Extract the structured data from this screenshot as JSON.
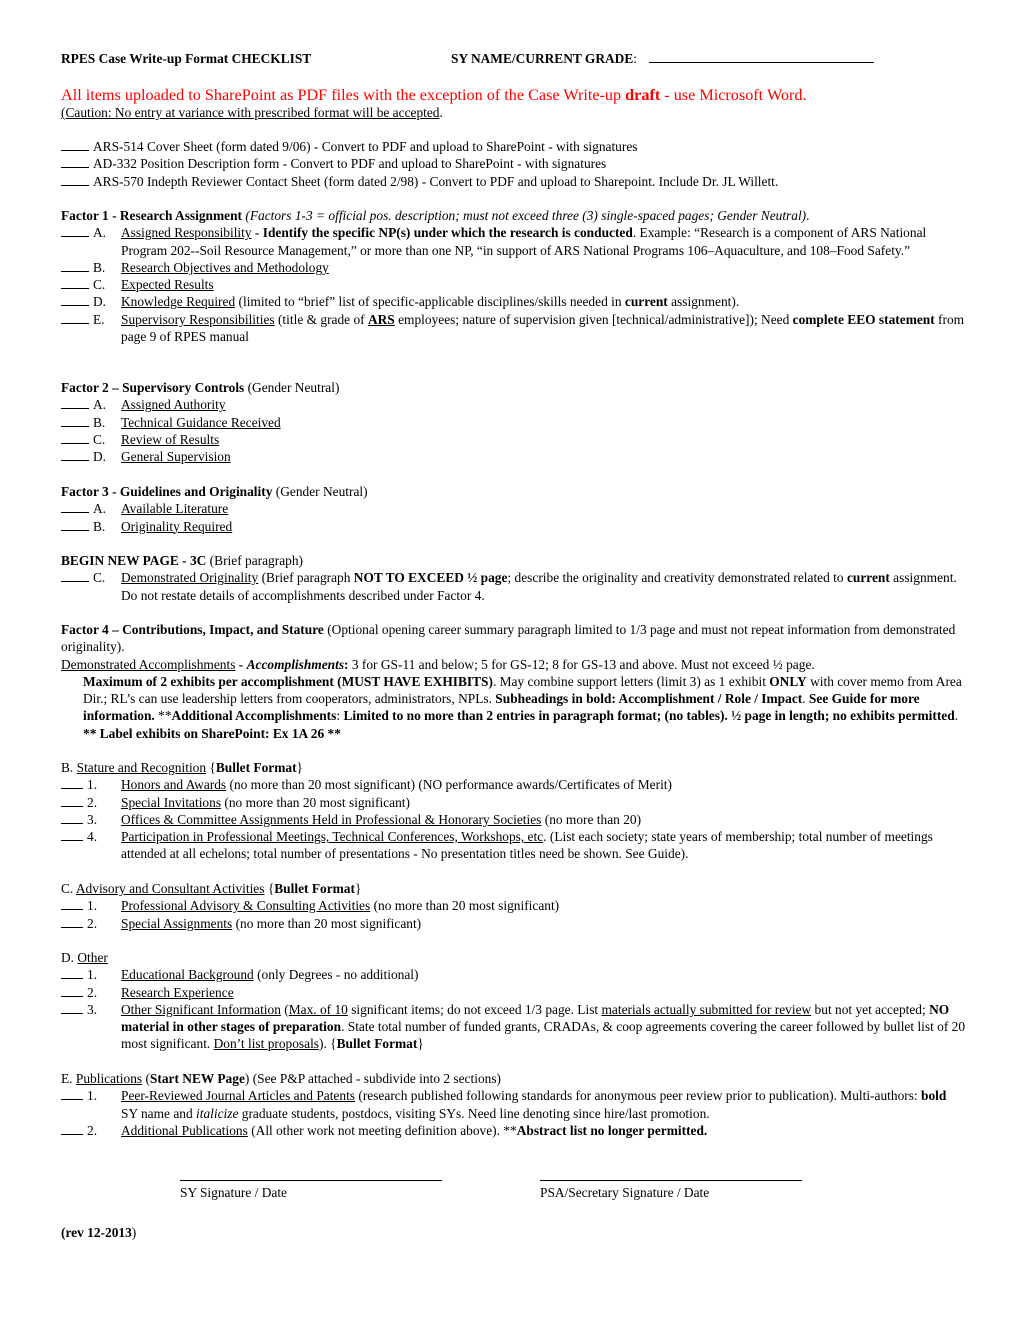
{
  "header": {
    "title": "RPES Case Write-up Format CHECKLIST",
    "sy_label": "SY NAME/CURRENT GRADE",
    "sy_colon": ":",
    "sy_value": ""
  },
  "notice": {
    "part1": "All items uploaded to SharePoint as PDF files with the exception of the Case Write-up ",
    "bold": "draft",
    "part2": " - use Microsoft Word."
  },
  "caution": {
    "text": "(Caution: No entry at variance with prescribed format will be accepted",
    "end": "."
  },
  "forms": [
    {
      "text": "ARS-514 Cover Sheet (form dated 9/06) - Convert to PDF and upload to SharePoint - with signatures"
    },
    {
      "text": "AD-332 Position Description form - Convert to PDF and upload to SharePoint - with signatures"
    },
    {
      "text": "ARS-570 Indepth Reviewer Contact Sheet (form dated 2/98) - Convert to PDF and upload to Sharepoint. Include Dr. JL Willett."
    }
  ],
  "factor1": {
    "title": "Factor 1 - Research Assignment",
    "note": "(Factors 1-3 = official pos. description; must not exceed three (3) single-spaced pages; Gender Neutral)",
    "note_end": ".",
    "items": [
      {
        "letter": "A.",
        "label": "Assigned Responsibility",
        "sep": " - ",
        "bold": "Identify the specific NP(s) under which the research is conducted",
        "rest": ". Example: “Research is a component of ARS National Program 202--Soil Resource Management,” or more than one NP, “in support of ARS National Programs 106–Aquaculture, and 108–Food Safety.”"
      },
      {
        "letter": "B.",
        "label": "Research Objectives and Methodology"
      },
      {
        "letter": "C.",
        "label": "Expected Results"
      },
      {
        "letter": "D.",
        "label": "Knowledge Required",
        "rest1": " (limited to “brief” list of specific-applicable disciplines/skills needed in ",
        "bold": "current",
        "rest2": " assignment)."
      },
      {
        "letter": "E.",
        "label": "Supervisory Responsibilities",
        "rest1": " (title & grade of ",
        "ars": "ARS",
        "rest2": " employees; nature of supervision given [technical/administrative]); Need ",
        "bold1": "complete EEO statement",
        "rest3": " from page 9 of RPES manual"
      }
    ]
  },
  "factor2": {
    "title": "Factor 2 – Supervisory Controls",
    "note": " (Gender Neutral)",
    "items": [
      {
        "letter": "A.",
        "label": "Assigned Authority"
      },
      {
        "letter": "B.",
        "label": "Technical Guidance Received"
      },
      {
        "letter": "C.",
        "label": "Review of Results"
      },
      {
        "letter": "D.",
        "label": "General Supervision"
      }
    ]
  },
  "factor3": {
    "title": "Factor 3 - Guidelines and Originality",
    "note": " (Gender Neutral)",
    "items": [
      {
        "letter": "A.",
        "label": "Available Literature"
      },
      {
        "letter": "B.",
        "label": "Originality Required"
      }
    ]
  },
  "newpage3c": {
    "title": "BEGIN NEW PAGE - 3C",
    "note": " (Brief paragraph)",
    "item": {
      "letter": "C.",
      "label": "Demonstrated Originality",
      "rest1": " (Brief paragraph ",
      "bold1": "NOT TO EXCEED ½ page",
      "rest2": "; describe the originality and creativity demonstrated related to ",
      "bold2": "current",
      "rest3": " assignment.  Do not restate details of accomplishments described under Factor 4."
    }
  },
  "factor4": {
    "title": "Factor 4 – Contributions, Impact, and Stature",
    "note": " (Optional opening career summary paragraph limited to 1/3 page and must not repeat information from demonstrated originality).",
    "accomplishments": {
      "label": "Demonstrated Accomplishments",
      "sep": " - ",
      "bold_italic": "Accomplishments",
      "colon": ":",
      "rest": "  3 for GS-11 and below; 5 for GS-12; 8 for GS-13 and above.  Must not exceed ½ page.",
      "bold1": "Maximum of 2 exhibits per accomplishment (MUST HAVE EXHIBITS)",
      "text1": ". May combine support letters (limit 3) as 1 exhibit ",
      "bold2": "ONLY",
      "text2": " with cover memo from Area Dir.; RL’s can use leadership letters from cooperators, administrators, NPLs. ",
      "bold3": "Subheadings in bold: Accomplishment / Role / Impact",
      "text3": ". ",
      "bold4": "See Guide for more information.",
      "text4": "  **",
      "bold5": "Additional Accomplishments",
      "text5": ": ",
      "bold6": "Limited to no more than 2 entries in paragraph format; (no tables).  ½ page in length; no exhibits permitted",
      "text6": ". ",
      "bold7": "** Label exhibits on SharePoint:  Ex 1A 26 **"
    }
  },
  "sectionB": {
    "letter": "B.",
    "label": "Stature and Recognition",
    "brace_open": " {",
    "bold": "Bullet Format",
    "brace_close": "}",
    "items": [
      {
        "num": "1.",
        "label": "Honors and Awards",
        "rest": " (no more than 20 most significant) (NO performance awards/Certificates of Merit)"
      },
      {
        "num": "2.",
        "label": "Special Invitations",
        "rest": " (no more than 20 most significant)"
      },
      {
        "num": "3.",
        "label": "Offices & Committee Assignments Held in Professional & Honorary Societies",
        "rest": " (no more than 20)"
      },
      {
        "num": "4.",
        "label": "Participation in Professional Meetings, Technical Conferences, Workshops, etc",
        "rest": ". (List each society; state years of membership; total number of meetings attended at all echelons; total number of presentations - No presentation titles need be shown.  See Guide)."
      }
    ]
  },
  "sectionC": {
    "letter": "C.",
    "label": "Advisory and Consultant Activities",
    "brace_open": " {",
    "bold": "Bullet Format",
    "brace_close": "}",
    "items": [
      {
        "num": "1.",
        "label": "Professional Advisory & Consulting Activities",
        "rest": " (no more than 20 most significant)"
      },
      {
        "num": "2.",
        "label": "Special Assignments",
        "rest": " (no more than 20 most significant)"
      }
    ]
  },
  "sectionD": {
    "letter": "D.",
    "label": "Other",
    "items": [
      {
        "num": "1.",
        "label": "Educational Background",
        "rest": " (only Degrees - no additional)"
      },
      {
        "num": "2.",
        "label": "Research Experience",
        "rest": ""
      },
      {
        "num": "3.",
        "label": "Other Significant Information",
        "t1": " (",
        "u1": "Max. of 10",
        "t2": " significant items; do not exceed 1/3 page.  List ",
        "u2": "materials actually submitted for review",
        "t3": " but not yet accepted; ",
        "b1": "NO material in other stages of preparation",
        "t4": ". State total number of funded grants, CRADAs, & coop agreements covering the career followed by bullet list of 20 most significant. ",
        "u3": "Don’t list proposals",
        "t5": ").  {",
        "b2": "Bullet Format",
        "t6": "}"
      }
    ]
  },
  "sectionE": {
    "letter": "E.",
    "label": "Publications",
    "t1": " (",
    "bold": "Start NEW Page",
    "t2": ") (See P&P attached - subdivide into 2 sections)",
    "items": [
      {
        "num": "1.",
        "label": "Peer-Reviewed Journal Articles and Patents",
        "t1": " (research published following standards for anonymous peer review prior to publication). Multi-authors: ",
        "b1": "bold",
        "t2": " SY name and ",
        "i1": "italicize",
        "t3": " graduate students, postdocs, visiting SYs.  Need line denoting since hire/last promotion."
      },
      {
        "num": "2.",
        "label": "Additional Publications",
        "t1": " (All other work not meeting definition above). **",
        "b1": "Abstract list no longer permitted."
      }
    ]
  },
  "signatures": {
    "sy": "SY Signature / Date",
    "psa": "PSA/Secretary Signature / Date"
  },
  "revision": {
    "open": "(",
    "text": "rev 12-2013",
    "close": ")"
  }
}
